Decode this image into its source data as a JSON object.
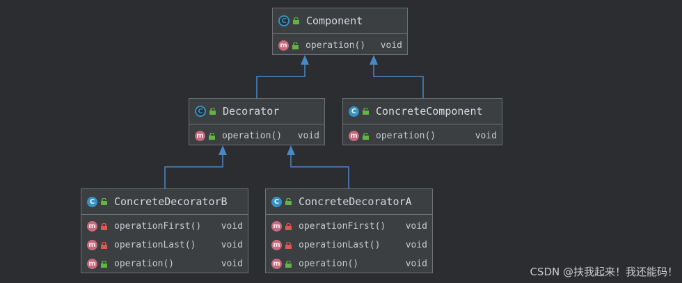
{
  "nodes": {
    "component": {
      "name": "Component",
      "icon": "C",
      "members": [
        {
          "icon": "m",
          "visibility": "public",
          "name": "operation()",
          "type": "void"
        }
      ]
    },
    "decorator": {
      "name": "Decorator",
      "icon": "C",
      "members": [
        {
          "icon": "m",
          "visibility": "public",
          "name": "operation()",
          "type": "void"
        }
      ]
    },
    "concrete_component": {
      "name": "ConcreteComponent",
      "icon": "C",
      "members": [
        {
          "icon": "m",
          "visibility": "public",
          "name": "operation()",
          "type": "void"
        }
      ]
    },
    "concrete_decorator_b": {
      "name": "ConcreteDecoratorB",
      "icon": "C",
      "members": [
        {
          "icon": "m",
          "visibility": "private",
          "name": "operationFirst()",
          "type": "void"
        },
        {
          "icon": "m",
          "visibility": "private",
          "name": "operationLast()",
          "type": "void"
        },
        {
          "icon": "m",
          "visibility": "public",
          "name": "operation()",
          "type": "void"
        }
      ]
    },
    "concrete_decorator_a": {
      "name": "ConcreteDecoratorA",
      "icon": "C",
      "members": [
        {
          "icon": "m",
          "visibility": "private",
          "name": "operationFirst()",
          "type": "void"
        },
        {
          "icon": "m",
          "visibility": "private",
          "name": "operationLast()",
          "type": "void"
        },
        {
          "icon": "m",
          "visibility": "public",
          "name": "operation()",
          "type": "void"
        }
      ]
    }
  },
  "edges": [
    {
      "from": "decorator",
      "to": "component",
      "kind": "inheritance"
    },
    {
      "from": "concrete_component",
      "to": "component",
      "kind": "inheritance"
    },
    {
      "from": "concrete_decorator_b",
      "to": "decorator",
      "kind": "inheritance"
    },
    {
      "from": "concrete_decorator_a",
      "to": "decorator",
      "kind": "inheritance"
    }
  ],
  "colors": {
    "background": "#2b2d30",
    "node_fill": "#3c3f41",
    "node_border": "#6e7275",
    "edge": "#4a88c7",
    "class_icon": "#3592c4",
    "method_icon": "#c76a7d",
    "public_icon": "#62b543",
    "private_icon": "#e0584b"
  },
  "watermark": "CSDN @扶我起来！我还能码！"
}
